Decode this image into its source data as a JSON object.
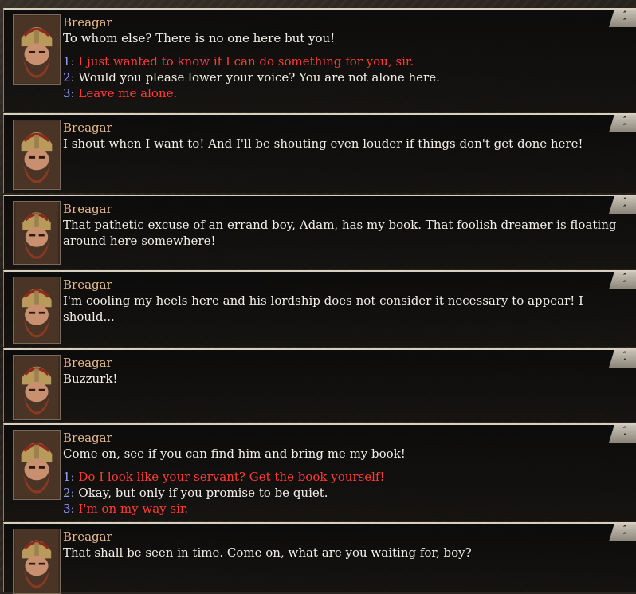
{
  "dialog": [
    {
      "speaker": "Breagar",
      "text": "To whom else? There is no one here but you!",
      "choices": [
        {
          "num": "1:",
          "text": "I just wanted to know if I can do something for you, sir.",
          "color": "red"
        },
        {
          "num": "2:",
          "text": "Would you please lower your voice? You are not alone here.",
          "color": "white"
        },
        {
          "num": "3:",
          "text": "Leave me alone.",
          "color": "red"
        }
      ]
    },
    {
      "speaker": "Breagar",
      "text": "I shout when I want to! And I'll be shouting even louder if things don't get done here!"
    },
    {
      "speaker": "Breagar",
      "text": "That pathetic excuse of an errand boy, Adam, has my book. That foolish dreamer is floating around here somewhere!"
    },
    {
      "speaker": "Breagar",
      "text": "I'm cooling my heels here and his lordship does not consider it necessary to appear! I should..."
    },
    {
      "speaker": "Breagar",
      "text": "Buzzurk!"
    },
    {
      "speaker": "Breagar",
      "text": "Come on, see if you can find him and bring me my book!",
      "choices": [
        {
          "num": "1:",
          "text": "Do I look like your servant? Get the book yourself!",
          "color": "red"
        },
        {
          "num": "2:",
          "text": "Okay, but only if you promise to be quiet.",
          "color": "white"
        },
        {
          "num": "3:",
          "text": "I'm on my way sir.",
          "color": "red"
        }
      ]
    },
    {
      "speaker": "Breagar",
      "text": "That shall be seen in time. Come on, what are you waiting for, boy?"
    }
  ],
  "colors": {
    "speaker": "#e8b98a",
    "choice_red": "#ff3a30",
    "choice_white": "#f2eee8",
    "choice_num": "#8fa0ff"
  },
  "icons": {
    "portrait": "dwarf-portrait",
    "collapse": "double-chevron-up-icon"
  }
}
